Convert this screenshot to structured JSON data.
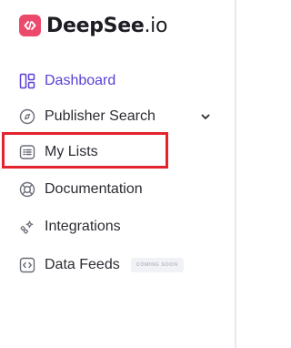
{
  "brand": {
    "name": "DeepSee",
    "tld": ".io",
    "logo_icon": "code-brackets-icon",
    "logo_color": "#ec4a6d"
  },
  "nav": {
    "items": [
      {
        "label": "Dashboard",
        "icon": "dashboard-grid-icon",
        "active": true
      },
      {
        "label": "Publisher Search",
        "icon": "compass-icon",
        "expandable": true,
        "chevron_icon": "chevron-down-icon"
      },
      {
        "label": "My Lists",
        "icon": "list-icon"
      },
      {
        "label": "Documentation",
        "icon": "lifebuoy-icon"
      },
      {
        "label": "Integrations",
        "icon": "integrations-icon"
      },
      {
        "label": "Data Feeds",
        "icon": "code-box-icon",
        "badge": "COMING SOON"
      }
    ]
  },
  "colors": {
    "active": "#5a3fd4",
    "text": "#2b2b33",
    "highlight": "#e3232d",
    "badge_bg": "#f1f2f6",
    "badge_text": "#b7bac4"
  }
}
